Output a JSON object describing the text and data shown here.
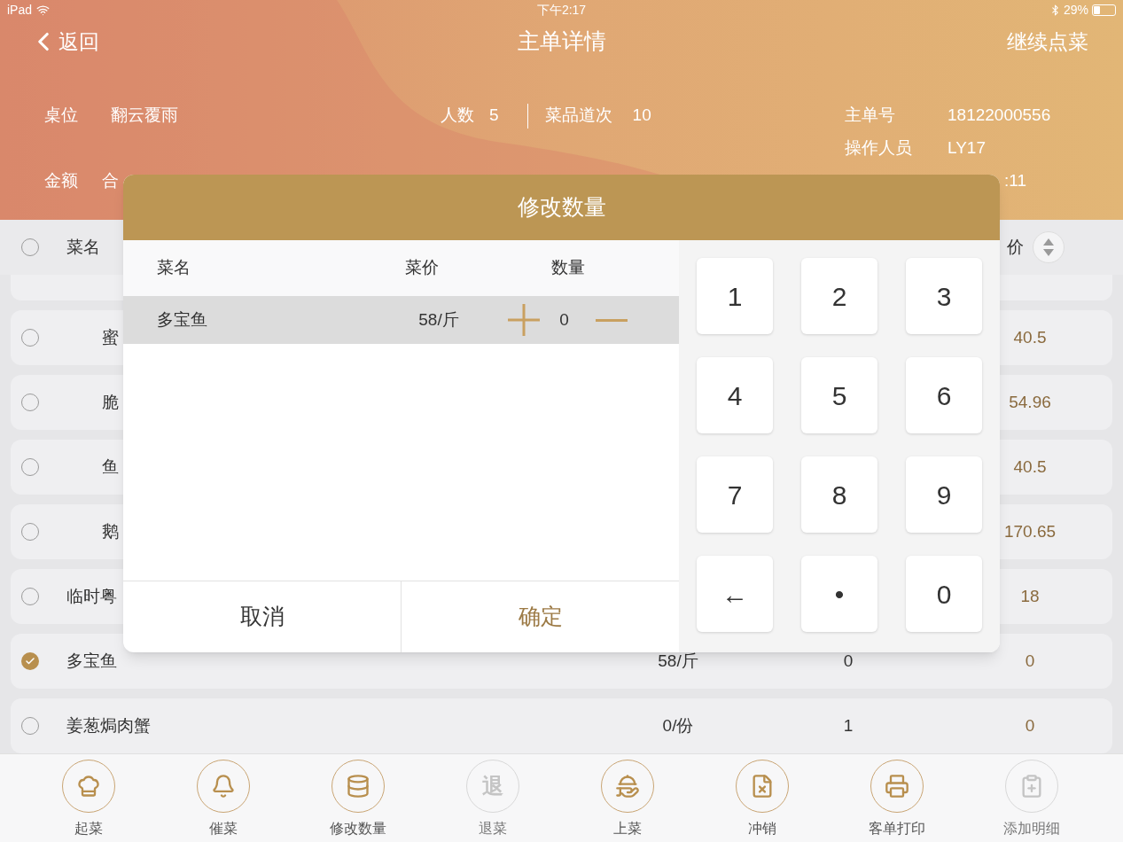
{
  "status_bar": {
    "carrier": "iPad",
    "time": "下午2:17",
    "battery": "29%"
  },
  "nav": {
    "back": "返回",
    "title": "主单详情",
    "action": "继续点菜"
  },
  "order_info": {
    "table": {
      "label": "桌位",
      "value": "翻云覆雨"
    },
    "amount": {
      "label": "金额",
      "value": "合"
    },
    "guests": {
      "label": "人数",
      "value": "5"
    },
    "courses": {
      "label": "菜品道次",
      "value": "10"
    },
    "order_no": {
      "label": "主单号",
      "value": "18122000556"
    },
    "operator": {
      "label": "操作人员",
      "value": "LY17"
    },
    "time_fragment": ":11"
  },
  "table": {
    "header": {
      "selected": false,
      "name": "菜名",
      "total": "价"
    },
    "rows": [
      {
        "children": [
          {
            "name": "蜜",
            "selected": false,
            "total": "40.5"
          },
          {
            "name": "脆",
            "selected": false,
            "total": "54.96"
          },
          {
            "name": "鱼",
            "selected": false,
            "total": "40.5"
          },
          {
            "name": "鹅",
            "selected": false,
            "total": "170.65"
          }
        ]
      },
      {
        "name": "临时粤",
        "selected": false,
        "total": "18"
      },
      {
        "name": "多宝鱼",
        "selected": true,
        "price": "58/斤",
        "quantity": "0",
        "total": "0"
      },
      {
        "name": "姜葱焗肉蟹",
        "selected": false,
        "price": "0/份",
        "quantity": "1",
        "total": "0"
      }
    ]
  },
  "dialog": {
    "title": "修改数量",
    "columns": [
      "菜名",
      "菜价",
      "数量"
    ],
    "items": [
      {
        "name": "多宝鱼",
        "price": "58/斤",
        "quantity": "0",
        "selected": true
      }
    ],
    "keys": [
      "1",
      "2",
      "3",
      "4",
      "5",
      "6",
      "7",
      "8",
      "9",
      "←",
      "•",
      "0"
    ],
    "buttons": [
      {
        "label": "取消",
        "kind": "cancel"
      },
      {
        "label": "确定",
        "kind": "confirm"
      }
    ]
  },
  "toolbar": [
    {
      "label": "起菜",
      "disabled": false
    },
    {
      "label": "催菜",
      "disabled": false
    },
    {
      "label": "修改数量",
      "disabled": false
    },
    {
      "label": "退菜",
      "glyph": "退",
      "disabled": true
    },
    {
      "label": "上菜",
      "disabled": false
    },
    {
      "label": "冲销",
      "disabled": false
    },
    {
      "label": "客单打印",
      "disabled": false
    },
    {
      "label": "添加明细",
      "disabled": true
    }
  ]
}
